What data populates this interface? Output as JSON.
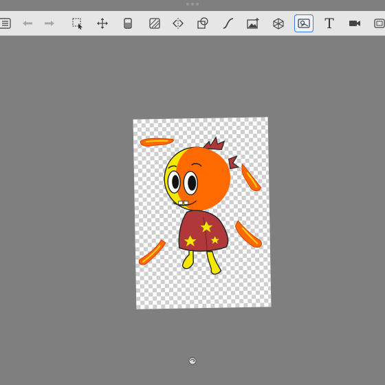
{
  "toolbar": {
    "tools": [
      {
        "name": "layers-list-icon"
      },
      {
        "name": "undo-icon"
      },
      {
        "name": "redo-icon"
      },
      {
        "name": "selection-icon"
      },
      {
        "name": "move-icon"
      },
      {
        "name": "fill-icon"
      },
      {
        "name": "hatch-icon"
      },
      {
        "name": "flip-icon"
      },
      {
        "name": "shapes-icon"
      },
      {
        "name": "curve-icon"
      },
      {
        "name": "image-import-icon"
      },
      {
        "name": "perspective-icon"
      },
      {
        "name": "reference-icon",
        "active": true
      },
      {
        "name": "text-icon",
        "label": "T"
      },
      {
        "name": "video-icon"
      },
      {
        "name": "frame-icon"
      }
    ],
    "accent": "#3b7ae0"
  },
  "canvas": {
    "background": "transparent-checker",
    "character_colors": {
      "face_yellow": "#f5e800",
      "face_orange": "#ff6a00",
      "shirt": "#b0383a",
      "stars": "#f5e800"
    }
  }
}
